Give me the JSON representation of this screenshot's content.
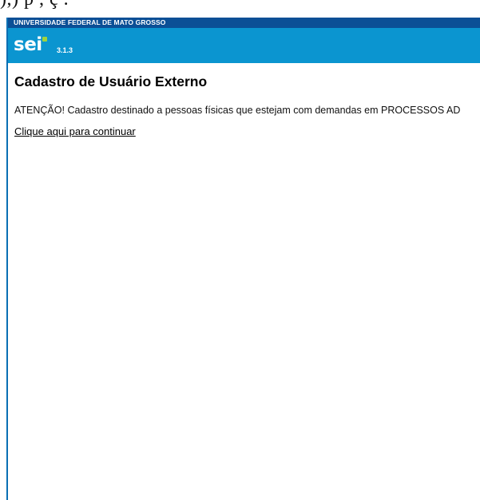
{
  "document_top_fragment": "),) p                                        ,                     ç                          .",
  "header": {
    "organization": "UNIVERSIDADE FEDERAL DE MATO GROSSO",
    "logo_text": "sei",
    "version": "3.1.3",
    "colors": {
      "org_bar": "#0b4f96",
      "brand_bar": "#0b95d0",
      "logo_accent": "#9fd33c"
    }
  },
  "main": {
    "title": "Cadastro de Usuário Externo",
    "notice": "ATENÇÃO! Cadastro destinado a pessoas físicas que estejam com demandas em PROCESSOS AD",
    "continue_link": "Clique aqui para continuar"
  }
}
